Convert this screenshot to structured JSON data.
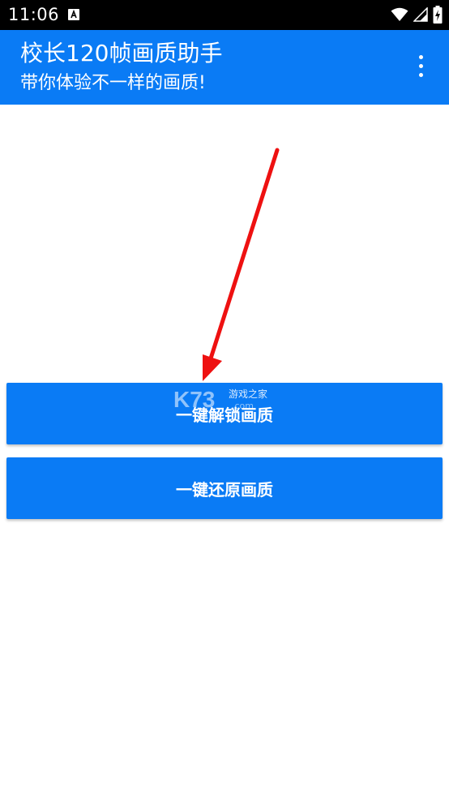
{
  "status_bar": {
    "time": "11:06",
    "notification_icon": "a-text-notification-icon",
    "icons": [
      "wifi-icon",
      "signal-icon",
      "battery-charging-icon"
    ]
  },
  "app_bar": {
    "title": "校长120帧画质助手",
    "subtitle": "带你体验不一样的画质!",
    "menu_icon": "more-vert-icon",
    "background_color": "#0a7bf5"
  },
  "buttons": {
    "unlock_label": "一键解锁画质",
    "restore_label": "一键还原画质"
  },
  "watermark": {
    "logo_text": "K73",
    "site_text": "游戏之家",
    "domain_text": ".com"
  },
  "annotation": {
    "arrow_color": "#ee1111"
  }
}
